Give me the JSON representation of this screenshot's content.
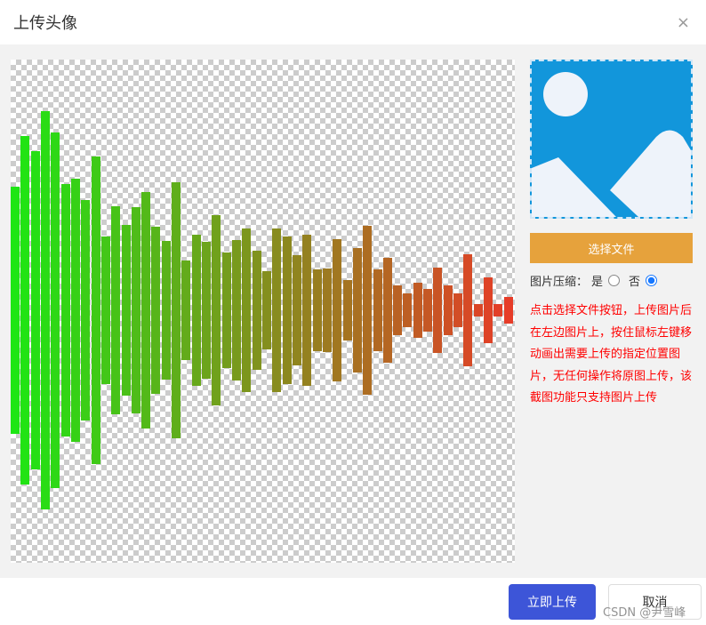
{
  "dialog": {
    "title": "上传头像",
    "close_icon": "×"
  },
  "side": {
    "choose_file": "选择文件",
    "compress_label": "图片压缩：",
    "yes": "是",
    "no": "否",
    "compress_selected": "否",
    "tip": "点击选择文件按钮，上传图片后在左边图片上，按住鼠标左键移动画出需要上传的指定位置图片，无任何操作将原图上传，该截图功能只支持图片上传"
  },
  "footer": {
    "upload": "立即上传",
    "cancel": "取消"
  },
  "watermark": "CSDN @尹雪峰",
  "colors": {
    "accent": "#3d55d8",
    "choose": "#e6a23c",
    "tip": "#ff0000",
    "preview_bg": "#1296db"
  }
}
